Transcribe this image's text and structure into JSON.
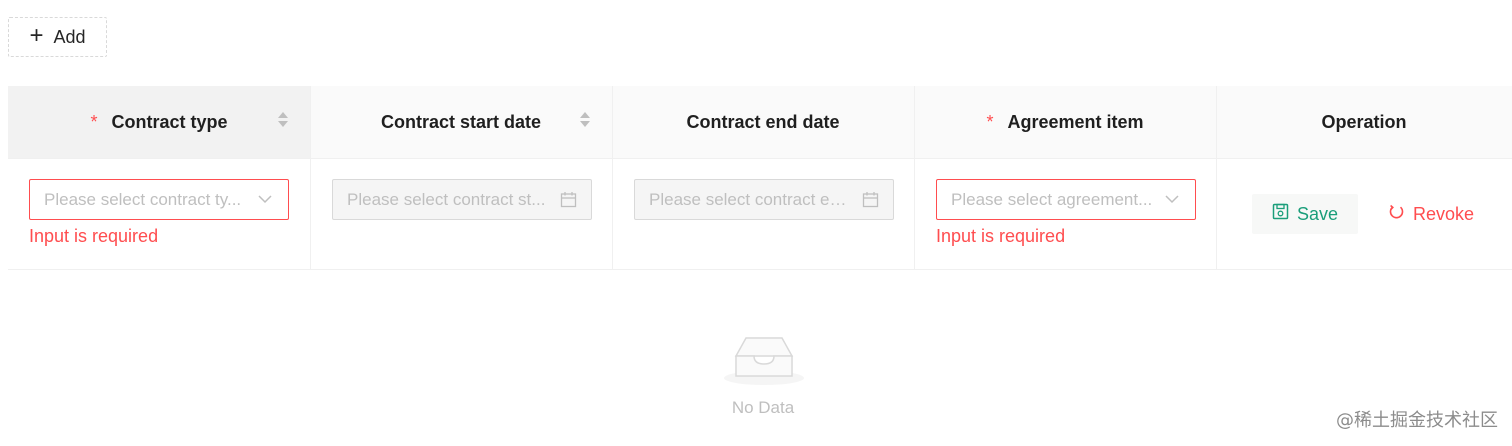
{
  "toolbar": {
    "add_label": "Add",
    "add_icon": "plus-icon"
  },
  "table": {
    "columns": [
      {
        "label": "Contract type",
        "required": "*",
        "sortable": true
      },
      {
        "label": "Contract start date",
        "required": "",
        "sortable": true
      },
      {
        "label": "Contract end date",
        "required": "",
        "sortable": false
      },
      {
        "label": "Agreement item",
        "required": "*",
        "sortable": false
      },
      {
        "label": "Operation",
        "required": "",
        "sortable": false
      }
    ],
    "row": {
      "contract_type": {
        "placeholder": "Please select contract ty...",
        "error": "Input is required",
        "suffix_icon": "chevron-down-icon"
      },
      "contract_start_date": {
        "placeholder": "Please select contract st...",
        "suffix_icon": "calendar-icon",
        "disabled": true
      },
      "contract_end_date": {
        "placeholder": "Please select contract en...",
        "suffix_icon": "calendar-icon",
        "disabled": true
      },
      "agreement_item": {
        "placeholder": "Please select agreement...",
        "error": "Input is required",
        "suffix_icon": "chevron-down-icon"
      },
      "operation": {
        "save_label": "Save",
        "save_icon": "save-icon",
        "revoke_label": "Revoke",
        "revoke_icon": "revoke-icon"
      }
    },
    "empty_text": "No Data"
  },
  "watermark": "@稀土掘金技术社区",
  "colors": {
    "error": "#ff4d4f",
    "save": "#1a9e7a",
    "header_bg": "#fafafa"
  }
}
